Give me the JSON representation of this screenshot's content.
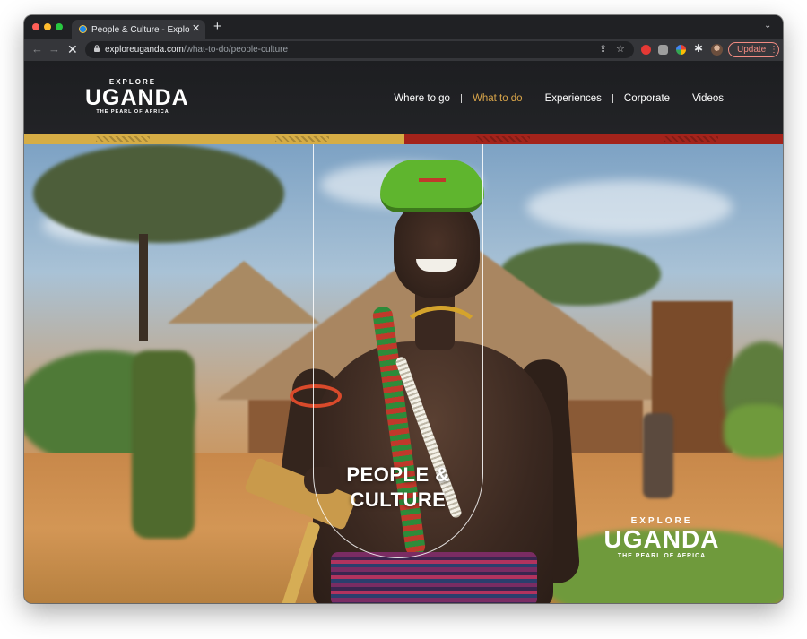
{
  "browser": {
    "tab": {
      "title": "People & Culture - Explore Uganda",
      "close_glyph": "✕"
    },
    "new_tab_glyph": "+",
    "tab_search_glyph": "⌄",
    "toolbar": {
      "back_glyph": "←",
      "forward_glyph": "→",
      "stop_glyph": "✕",
      "url_host": "exploreuganda.com",
      "url_path": "/what-to-do/people-culture",
      "share_glyph": "⇪",
      "star_glyph": "☆",
      "extensions_glyph": "✱",
      "update_label": "Update",
      "menu_glyph": "⋮"
    }
  },
  "site": {
    "logo": {
      "explore": "EXPLORE",
      "name": "UGANDA",
      "tagline": "THE PEARL OF AFRICA"
    },
    "nav": [
      {
        "label": "Where to go",
        "active": false
      },
      {
        "label": "What to do",
        "active": true
      },
      {
        "label": "Experiences",
        "active": false
      },
      {
        "label": "Corporate",
        "active": false
      },
      {
        "label": "Videos",
        "active": false
      }
    ],
    "hero": {
      "title_line1": "PEOPLE &",
      "title_line2": "CULTURE"
    },
    "watermark": {
      "explore": "EXPLORE",
      "name": "UGANDA",
      "tagline": "THE PEARL OF AFRICA"
    }
  },
  "colors": {
    "accent_gold": "#d6ad45",
    "accent_red": "#a3231b",
    "nav_active": "#d9a54a",
    "update_button": "#f28b82"
  },
  "icons": [
    "lock-icon",
    "share-icon",
    "bookmark-star-icon",
    "extensions-puzzle-icon",
    "profile-avatar-icon"
  ]
}
